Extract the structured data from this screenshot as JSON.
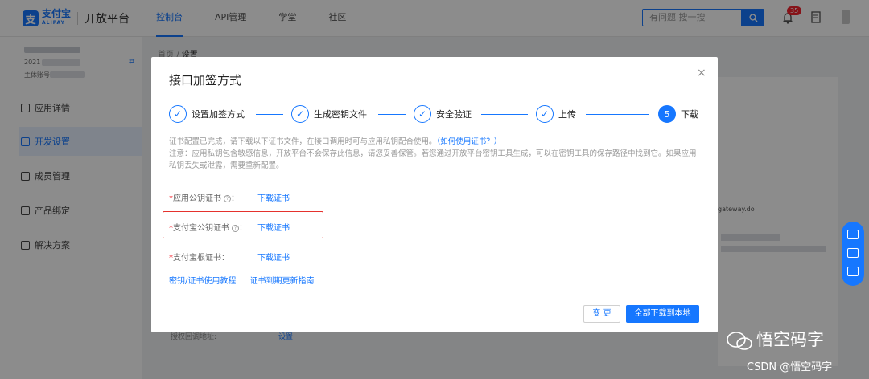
{
  "topbar": {
    "logo_mark": "支",
    "logo_name": "支付宝",
    "logo_sub": "ALIPAY",
    "product": "开放平台",
    "nav": [
      "控制台",
      "API管理",
      "学堂",
      "社区"
    ],
    "search_placeholder": "有问题 搜一搜",
    "notifications": "35"
  },
  "sidebar": {
    "app_year": "2021",
    "owner_label": "主体账号",
    "swap": "⇄",
    "items": [
      "应用详情",
      "开发设置",
      "成员管理",
      "产品绑定",
      "解决方案"
    ]
  },
  "breadcrumb": {
    "home": "首页",
    "sep": "/",
    "current": "设置"
  },
  "background": {
    "gateway": "gateway.do",
    "bottom_label": "授权回调地址:",
    "bottom_link": "设置"
  },
  "modal": {
    "title": "接口加签方式",
    "close": "×",
    "steps": [
      {
        "label": "设置加签方式",
        "mark": "✓"
      },
      {
        "label": "生成密钥文件",
        "mark": "✓"
      },
      {
        "label": "安全验证",
        "mark": "✓"
      },
      {
        "label": "上传",
        "mark": "✓"
      },
      {
        "label": "下载",
        "mark": "5"
      }
    ],
    "notice_line1": "证书配置已完成，请下载以下证书文件，在接口调用时可与应用私钥配合使用。",
    "notice_link": "（如何使用证书？）",
    "notice_line2": "注意：应用私钥包含敏感信息，开放平台不会保存此信息，请您妥善保管。若您通过开放平台密钥工具生成，可以在密钥工具的保存路径中找到它。如果应用私钥丢失或泄露，需要重新配置。",
    "certs": [
      {
        "required": "*",
        "label": "应用公钥证书",
        "help": "?",
        "colon": "：",
        "link": "下载证书"
      },
      {
        "required": "*",
        "label": "支付宝公钥证书",
        "help": "?",
        "colon": "：",
        "link": "下载证书"
      },
      {
        "required": "*",
        "label": "支付宝根证书",
        "help": "",
        "colon": "：",
        "link": "下载证书"
      }
    ],
    "bottom_links": [
      "密钥/证书使用教程",
      "证书到期更新指南"
    ],
    "btn_change": "变 更",
    "btn_download_all": "全部下载到本地"
  },
  "watermark": {
    "name": "悟空码字",
    "csdn": "CSDN @悟空码字"
  },
  "colors": {
    "primary": "#1677ff",
    "danger": "#f5222d",
    "highlight": "#e5322d"
  }
}
